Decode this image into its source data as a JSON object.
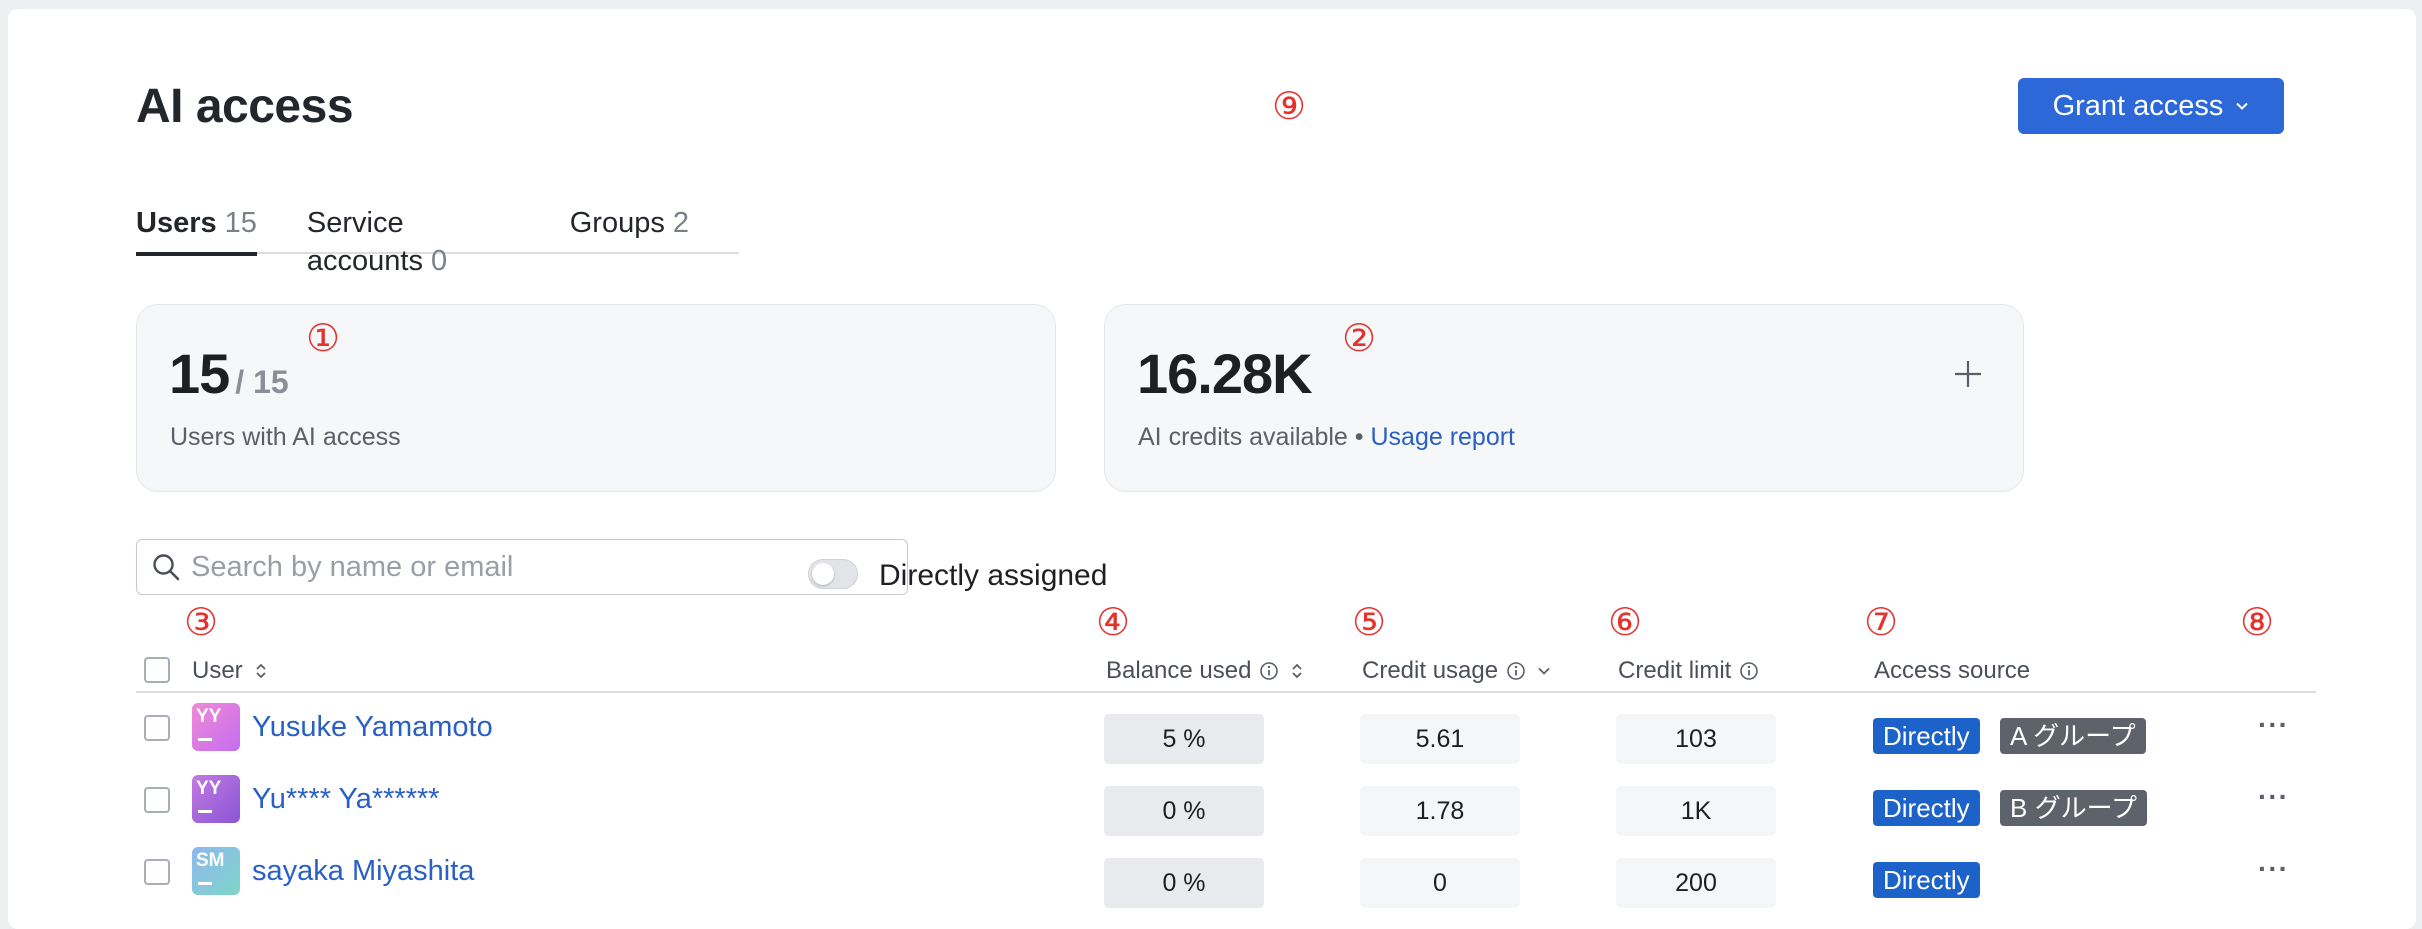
{
  "page": {
    "title": "AI access"
  },
  "header": {
    "grant_label": "Grant access"
  },
  "markers": [
    "⑨",
    "①",
    "②",
    "③",
    "④",
    "⑤",
    "⑥",
    "⑦",
    "⑧"
  ],
  "tabs": [
    {
      "label": "Users",
      "count": "15"
    },
    {
      "label": "Service accounts",
      "count": "0"
    },
    {
      "label": "Groups",
      "count": "2"
    }
  ],
  "cards": {
    "users": {
      "value": "15",
      "total": "/ 15",
      "caption": "Users with AI access"
    },
    "credits": {
      "value": "16.28K",
      "caption": "AI credits available •",
      "link": "Usage report"
    }
  },
  "search": {
    "placeholder": "Search by name or email"
  },
  "filter": {
    "label": "Directly assigned"
  },
  "table": {
    "columns": {
      "user": "User",
      "balance": "Balance used",
      "usage": "Credit usage",
      "limit": "Credit limit",
      "source": "Access source"
    },
    "rows": [
      {
        "initials": "YY",
        "name": "Yusuke Yamamoto",
        "balance": "5 %",
        "usage": "5.61",
        "limit": "103",
        "source": "Directly",
        "group": "A グループ",
        "more": "···"
      },
      {
        "initials": "YY",
        "name": "Yu**** Ya******",
        "balance": "0 %",
        "usage": "1.78",
        "limit": "1K",
        "source": "Directly",
        "group": "B グループ",
        "more": "···"
      },
      {
        "initials": "SM",
        "name": "sayaka Miyashita",
        "balance": "0 %",
        "usage": "0",
        "limit": "200",
        "source": "Directly",
        "group": "",
        "more": "···"
      }
    ]
  },
  "colors": {
    "accent": "#2c68d8",
    "link": "#2a5fc4",
    "badge_directly": "#1d62c9",
    "badge_group": "#5d626b",
    "marker": "#e5322d"
  },
  "icons": [
    "search-icon",
    "chevron-down-icon",
    "plus-icon",
    "sort-icon",
    "info-icon",
    "more-icon"
  ]
}
